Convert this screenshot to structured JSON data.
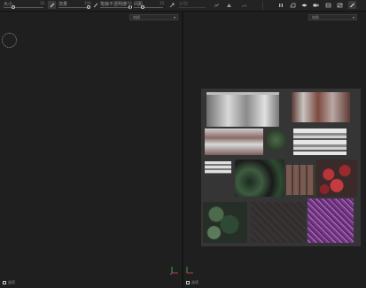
{
  "toolbar": {
    "size_label": "大小",
    "size_value": "10",
    "size_fraction": 0.25,
    "flow_label": "流量",
    "flow_value": "100",
    "flow_fraction": 0.98,
    "stroke_opacity_label": "笔触不透明度",
    "stroke_opacity_value": "100",
    "stroke_opacity_fraction": 0.98,
    "spacing_label": "间距",
    "spacing_value": "15",
    "spacing_fraction": 0.3,
    "disabled_label": "对称",
    "icons": [
      "brush-icon",
      "flow-icon",
      "opacity-icon",
      "spacing-icon",
      "symmetry-icon",
      "align-icon",
      "mirror-icon",
      "pause-icon",
      "camera-orbit-icon",
      "environment-icon",
      "video-icon",
      "layers-icon",
      "display-icon",
      "paint-icon"
    ]
  },
  "left_viewport": {
    "dropdown": "材质",
    "footer_label": "选项"
  },
  "right_viewport": {
    "dropdown": "材质",
    "footer_label": "选项"
  },
  "colors": {
    "background": "#1e1e1e",
    "toolbar": "#232323",
    "uv_sheet": "#353535",
    "axis_x": "#d04a4a",
    "axis_y": "#5bb85b",
    "axis_z": "#6f6fe0"
  }
}
